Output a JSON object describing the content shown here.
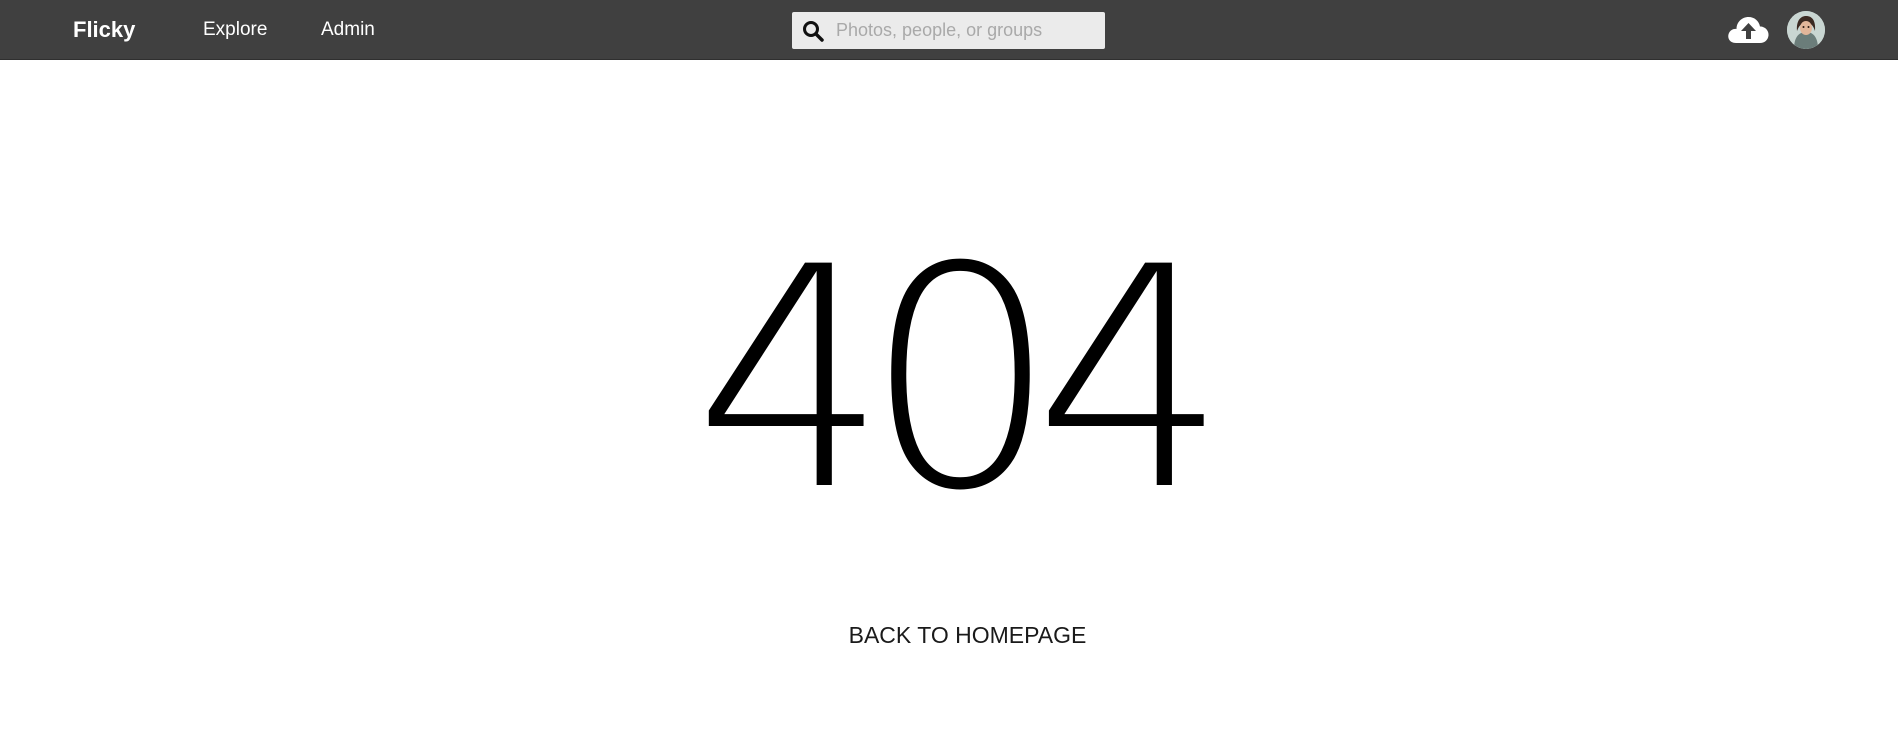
{
  "header": {
    "brand": "Flicky",
    "nav": [
      {
        "label": "Explore"
      },
      {
        "label": "Admin"
      }
    ],
    "search": {
      "placeholder": "Photos, people, or groups",
      "value": "",
      "icon": "search-icon"
    },
    "upload_icon": "cloud-upload-icon",
    "avatar_icon": "user-avatar"
  },
  "main": {
    "error_code": "404",
    "back_link": "BACK TO HOMEPAGE"
  },
  "colors": {
    "header_bg": "#404040",
    "header_text": "#ffffff",
    "search_bg": "#ebebeb",
    "page_bg": "#ffffff",
    "error_text": "#000000"
  }
}
